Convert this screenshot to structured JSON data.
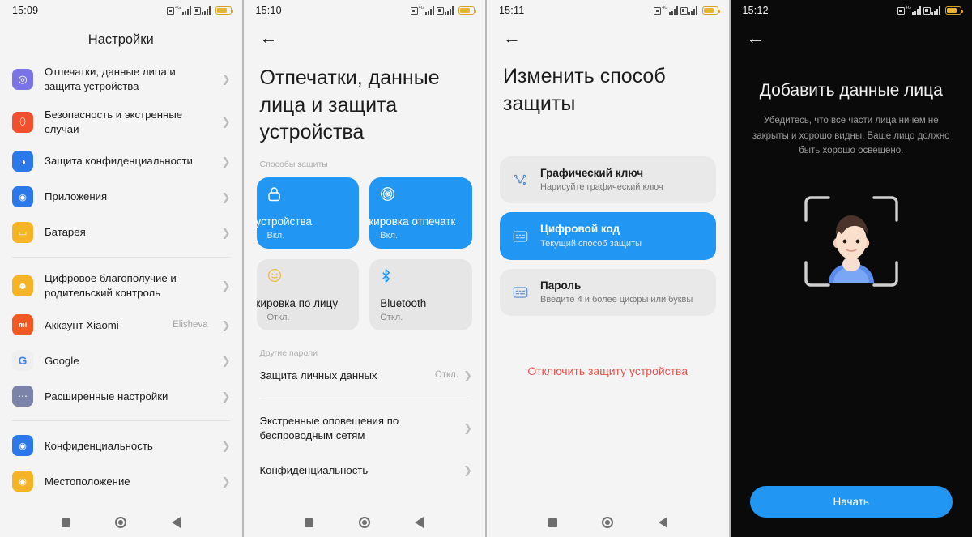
{
  "panels": [
    {
      "id": "settings",
      "theme": "light",
      "status": {
        "clock": "15:09",
        "network": "4G",
        "battery_icon": "battery-icon",
        "sim_icon": "sim-signal-icon"
      },
      "title": "Настройки",
      "items": [
        {
          "label": "Отпечатки, данные лица и защита устройства",
          "value": "",
          "icon": "fingerprint-icon",
          "icon_bg": "#7a73e6",
          "glyph": "◎"
        },
        {
          "label": "Безопасность и экстренные случаи",
          "value": "",
          "icon": "shield-sos-icon",
          "icon_bg": "#f0502e",
          "glyph": "▯"
        },
        {
          "label": "Защита конфиденциальности",
          "value": "",
          "icon": "privacy-shield-icon",
          "icon_bg": "#2b79e8",
          "glyph": "◑"
        },
        {
          "label": "Приложения",
          "value": "",
          "icon": "apps-icon",
          "icon_bg": "#2b79e8",
          "glyph": "◉"
        },
        {
          "label": "Батарея",
          "value": "",
          "icon": "battery-settings-icon",
          "icon_bg": "#f5b425",
          "glyph": "▭"
        },
        {
          "sep": true
        },
        {
          "label": "Цифровое благополучие и родительский контроль",
          "value": "",
          "icon": "digital-wellbeing-icon",
          "icon_bg": "#f5b425",
          "glyph": "☻"
        },
        {
          "label": "Аккаунт Xiaomi",
          "value": "Elisheva",
          "icon": "xiaomi-account-icon",
          "icon_bg": "#f05a22",
          "glyph": "mi"
        },
        {
          "label": "Google",
          "value": "",
          "icon": "google-icon",
          "icon_bg": "#efefef",
          "glyph": "G"
        },
        {
          "label": "Расширенные настройки",
          "value": "",
          "icon": "advanced-settings-icon",
          "icon_bg": "#7c83a8",
          "glyph": "⋯"
        },
        {
          "sep": true
        },
        {
          "label": "Конфиденциальность",
          "value": "",
          "icon": "eye-icon",
          "icon_bg": "#2b79e8",
          "glyph": "◉"
        },
        {
          "label": "Местоположение",
          "value": "",
          "icon": "location-pin-icon",
          "icon_bg": "#f5b425",
          "glyph": "◉"
        }
      ],
      "nav": {
        "recents": "recents-button",
        "home": "home-button",
        "back": "back-button"
      }
    },
    {
      "id": "biometrics",
      "theme": "light",
      "status": {
        "clock": "15:10",
        "network": "4G",
        "battery_icon": "battery-icon",
        "sim_icon": "sim-signal-icon"
      },
      "back": "←",
      "title": "Отпечатки, данные лица и защита устройства",
      "section_label": "Способы защиты",
      "tiles": [
        {
          "name": "устройства",
          "state": "Вкл.",
          "active": true,
          "icon": "lock-icon",
          "glyph": "🔒"
        },
        {
          "name": "кировка отпечатк",
          "state": "Вкл.",
          "active": true,
          "icon": "fingerprint-icon",
          "glyph": "◎"
        },
        {
          "name": "кировка по лицу",
          "state": "Откл.",
          "active": false,
          "icon": "face-smile-icon",
          "glyph": "☺"
        },
        {
          "name": "Bluetooth",
          "state": "Откл.",
          "active": false,
          "icon": "bluetooth-icon",
          "glyph": "✸"
        }
      ],
      "other_label": "Другие пароли",
      "rows": [
        {
          "label": "Защита личных данных",
          "value": "Откл."
        },
        {
          "sep": true
        },
        {
          "label": "Экстренные оповещения по беспроводным сетям",
          "value": ""
        },
        {
          "label": "Конфиденциальность",
          "value": ""
        }
      ],
      "nav": {
        "recents": "recents-button",
        "home": "home-button",
        "back": "back-button"
      }
    },
    {
      "id": "change-lock-method",
      "theme": "light",
      "status": {
        "clock": "15:11",
        "network": "4G",
        "battery_icon": "battery-icon",
        "sim_icon": "sim-signal-icon"
      },
      "back": "←",
      "title": "Изменить способ защиты",
      "options": [
        {
          "title": "Графический ключ",
          "subtitle": "Нарисуйте графический ключ",
          "selected": false,
          "icon": "pattern-lock-icon",
          "glyph": "⋈"
        },
        {
          "title": "Цифровой код",
          "subtitle": "Текущий способ защиты",
          "selected": true,
          "icon": "pin-code-icon",
          "glyph": "▦"
        },
        {
          "title": "Пароль",
          "subtitle": "Введите 4 и более цифры или буквы",
          "selected": false,
          "icon": "password-icon",
          "glyph": "▦"
        }
      ],
      "danger_link": "Отключить защиту устройства",
      "nav": {
        "recents": "recents-button",
        "home": "home-button",
        "back": "back-button"
      }
    },
    {
      "id": "add-face-data",
      "theme": "dark",
      "status": {
        "clock": "15:12",
        "network": "4G",
        "battery_icon": "battery-icon",
        "sim_icon": "sim-signal-icon"
      },
      "back": "←",
      "title": "Добавить данные лица",
      "description": "Убедитесь, что все части лица ничем не закрыты и хорошо видны. Ваше лицо должно быть хорошо освещено.",
      "illustration": "face-scan-illustration",
      "button": "Начать"
    }
  ],
  "colors": {
    "accent": "#2196f3",
    "danger": "#e8534f",
    "light_bg": "#f4f4f4",
    "dark_bg": "#0a0a0a",
    "tile_off": "#e6e6e6"
  }
}
